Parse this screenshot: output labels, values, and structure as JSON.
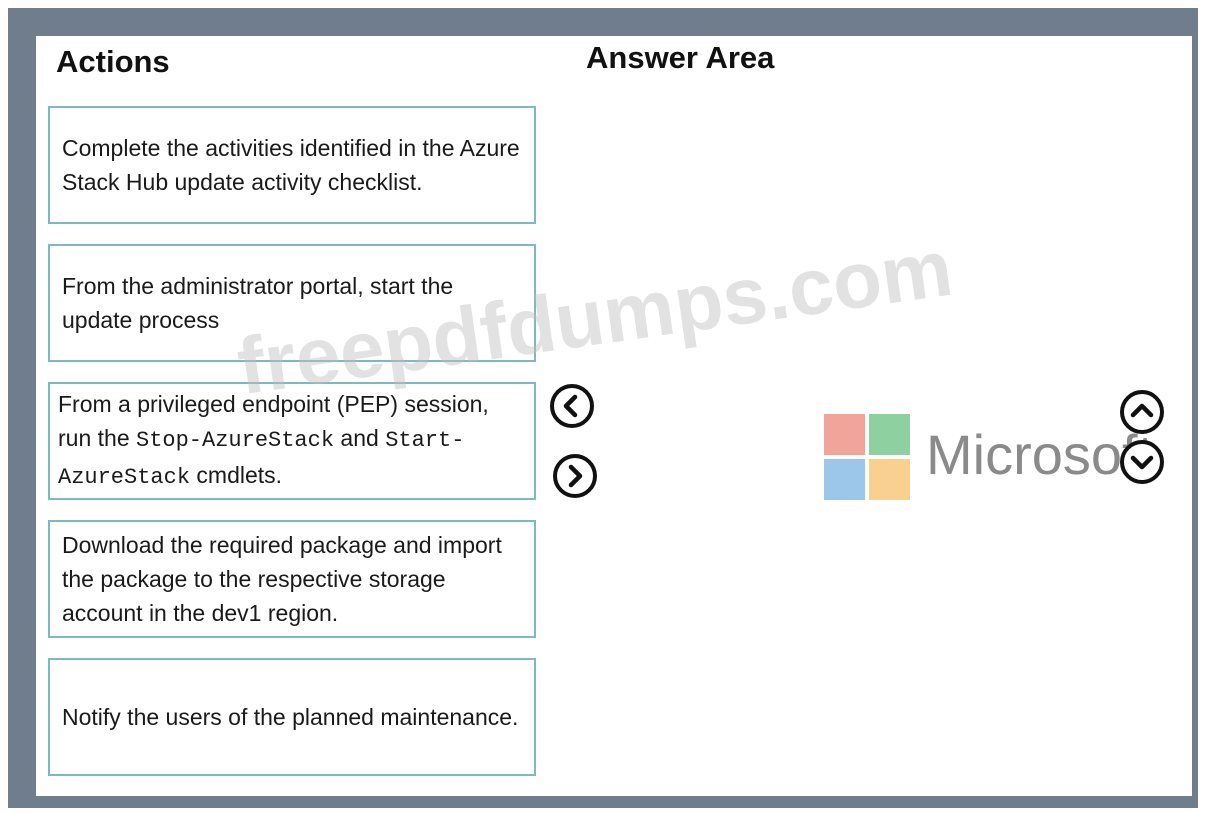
{
  "headings": {
    "actions": "Actions",
    "answer_area": "Answer Area"
  },
  "actions": [
    {
      "parts": [
        "Complete the activities identified in the Azure Stack Hub update activity checklist."
      ]
    },
    {
      "parts": [
        "From the administrator portal, start the update process"
      ]
    },
    {
      "text_a": "From a privileged endpoint (PEP) session, run the ",
      "code_a": "Stop-AzureStack",
      "text_b": " and ",
      "code_b": "Start-AzureStack",
      "text_c": " cmdlets."
    },
    {
      "parts": [
        "Download the required package and import the package to the respective storage account in the dev1 region."
      ]
    },
    {
      "parts": [
        "Notify the users of the planned maintenance."
      ]
    }
  ],
  "controls": {
    "move_left": "chevron-left-icon",
    "move_right": "chevron-right-icon",
    "move_up": "chevron-up-icon",
    "move_down": "chevron-down-icon"
  },
  "watermark": "freepdfdumps.com",
  "logo": {
    "word": "Microsoft",
    "colors": [
      "#f1a49a",
      "#8fd0a0",
      "#9cc6ea",
      "#f9d08f"
    ]
  }
}
